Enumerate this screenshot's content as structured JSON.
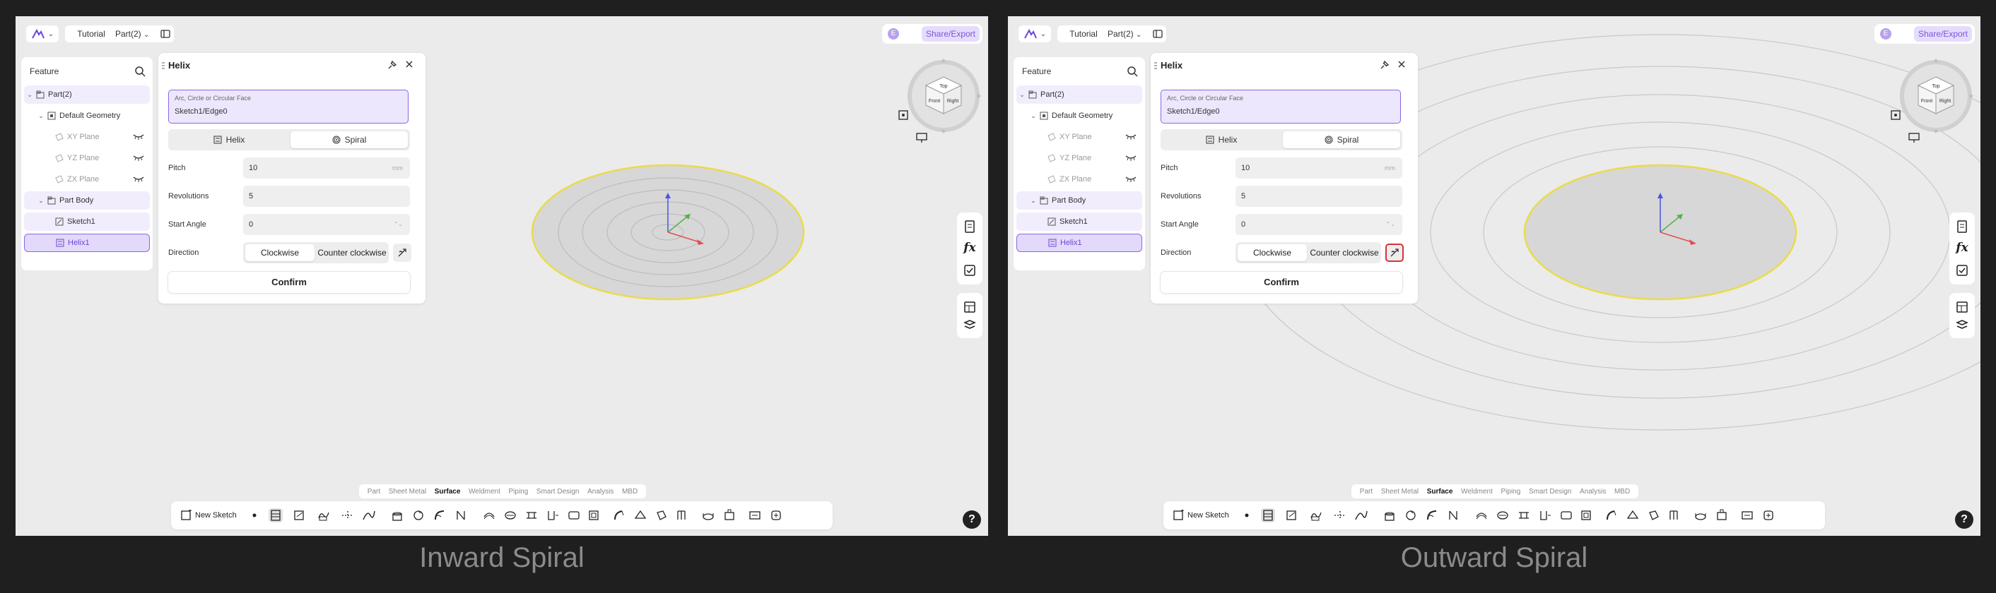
{
  "topbar": {
    "crumb_tutorial": "Tutorial",
    "crumb_part": "Part(2)",
    "user_initial": "E",
    "share_label": "Share/Export"
  },
  "feature_panel": {
    "title": "Feature",
    "items": [
      {
        "label": "Part(2)"
      },
      {
        "label": "Default Geometry"
      },
      {
        "label": "XY Plane"
      },
      {
        "label": "YZ Plane"
      },
      {
        "label": "ZX Plane"
      },
      {
        "label": "Part Body"
      },
      {
        "label": "Sketch1"
      },
      {
        "label": "Helix1"
      }
    ]
  },
  "helix_dialog": {
    "title": "Helix",
    "edge_label": "Arc, Circle or Circular Face",
    "edge_value": "Sketch1/Edge0",
    "mode_helix": "Helix",
    "mode_spiral": "Spiral",
    "pitch_label": "Pitch",
    "pitch_value": "10",
    "pitch_unit": "mm",
    "revolutions_label": "Revolutions",
    "revolutions_value": "5",
    "start_angle_label": "Start Angle",
    "start_angle_value": "0",
    "direction_label": "Direction",
    "clockwise": "Clockwise",
    "counter_clockwise": "Counter clockwise",
    "confirm": "Confirm"
  },
  "mode_tabs": [
    "Part",
    "Sheet Metal",
    "Surface",
    "Weldment",
    "Piping",
    "Smart Design",
    "Analysis",
    "MBD"
  ],
  "active_mode_tab": "Surface",
  "new_sketch": "New Sketch",
  "help": "?",
  "viewcube_faces": {
    "top": "Top",
    "front": "Front",
    "right": "Right"
  },
  "captions": {
    "left": "Inward Spiral",
    "right": "Outward Spiral"
  },
  "accent_color": "#8b66e8",
  "highlight_color": "#d9313a"
}
